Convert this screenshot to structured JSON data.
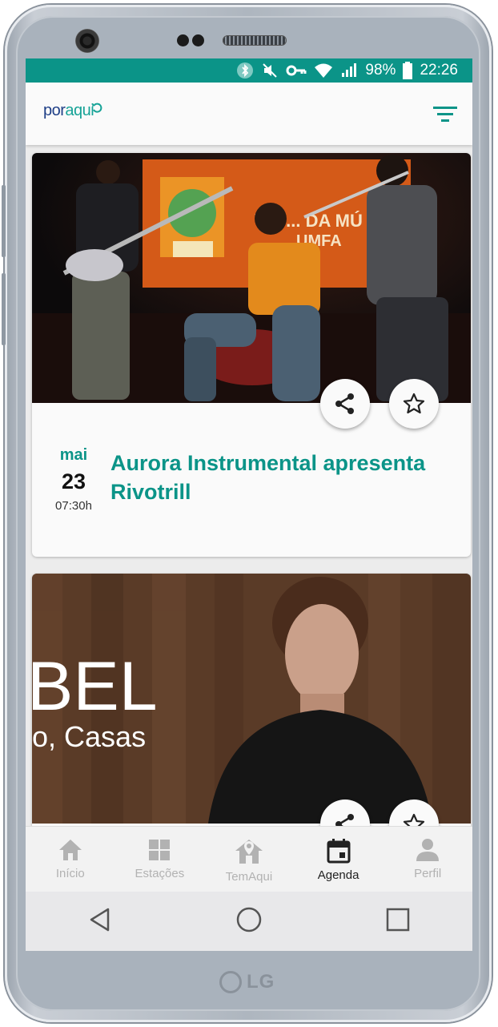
{
  "status_bar": {
    "battery": "98%",
    "time": "22:26"
  },
  "app": {
    "logo_part1": "por",
    "logo_part2": "aqui"
  },
  "events": [
    {
      "month": "mai",
      "day": "23",
      "time": "07:30h",
      "title": "Aurora Instrumental apresenta Rivotrill",
      "banner_text": "VIII ... DA MÚ... UMFA"
    },
    {
      "banner_text_1": "BEL",
      "banner_text_2": "o, Casas"
    }
  ],
  "nav": {
    "items": [
      "Início",
      "Estações",
      "TemAqui",
      "Agenda",
      "Perfil"
    ],
    "active": "Agenda"
  },
  "device": {
    "brand": "LG"
  },
  "colors": {
    "accent": "#0b9488",
    "brand_blue": "#1f3f87"
  }
}
